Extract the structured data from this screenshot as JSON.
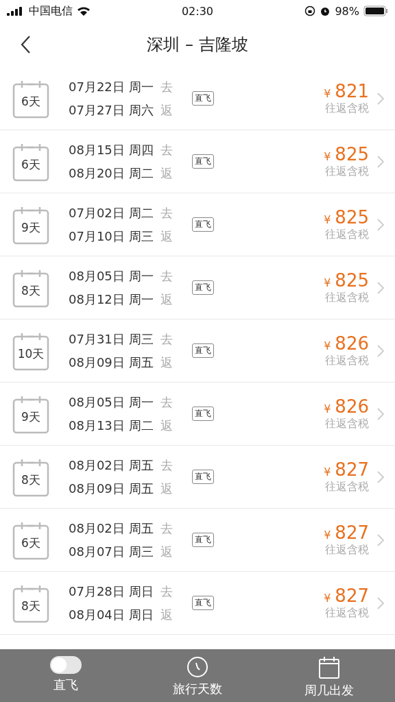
{
  "status_bar": {
    "carrier": "中国电信",
    "time": "02:30",
    "battery": "98%"
  },
  "nav": {
    "title": "深圳 – 吉隆坡"
  },
  "flights": [
    {
      "days": "6天",
      "out_date": "07月22日 周一",
      "out_tag": "去",
      "ret_date": "07月27日 周六",
      "ret_tag": "返",
      "badge": "直飞",
      "currency": "¥",
      "price": "821",
      "note": "往返含税"
    },
    {
      "days": "6天",
      "out_date": "08月15日 周四",
      "out_tag": "去",
      "ret_date": "08月20日 周二",
      "ret_tag": "返",
      "badge": "直飞",
      "currency": "¥",
      "price": "825",
      "note": "往返含税"
    },
    {
      "days": "9天",
      "out_date": "07月02日 周二",
      "out_tag": "去",
      "ret_date": "07月10日 周三",
      "ret_tag": "返",
      "badge": "直飞",
      "currency": "¥",
      "price": "825",
      "note": "往返含税"
    },
    {
      "days": "8天",
      "out_date": "08月05日 周一",
      "out_tag": "去",
      "ret_date": "08月12日 周一",
      "ret_tag": "返",
      "badge": "直飞",
      "currency": "¥",
      "price": "825",
      "note": "往返含税"
    },
    {
      "days": "10天",
      "out_date": "07月31日 周三",
      "out_tag": "去",
      "ret_date": "08月09日 周五",
      "ret_tag": "返",
      "badge": "直飞",
      "currency": "¥",
      "price": "826",
      "note": "往返含税"
    },
    {
      "days": "9天",
      "out_date": "08月05日 周一",
      "out_tag": "去",
      "ret_date": "08月13日 周二",
      "ret_tag": "返",
      "badge": "直飞",
      "currency": "¥",
      "price": "826",
      "note": "往返含税"
    },
    {
      "days": "8天",
      "out_date": "08月02日 周五",
      "out_tag": "去",
      "ret_date": "08月09日 周五",
      "ret_tag": "返",
      "badge": "直飞",
      "currency": "¥",
      "price": "827",
      "note": "往返含税"
    },
    {
      "days": "6天",
      "out_date": "08月02日 周五",
      "out_tag": "去",
      "ret_date": "08月07日 周三",
      "ret_tag": "返",
      "badge": "直飞",
      "currency": "¥",
      "price": "827",
      "note": "往返含税"
    },
    {
      "days": "8天",
      "out_date": "07月28日 周日",
      "out_tag": "去",
      "ret_date": "08月04日 周日",
      "ret_tag": "返",
      "badge": "直飞",
      "currency": "¥",
      "price": "827",
      "note": "往返含税"
    }
  ],
  "bottom_bar": [
    {
      "kind": "toggle",
      "label": "直飞",
      "on": false
    },
    {
      "kind": "clock",
      "label": "旅行天数"
    },
    {
      "kind": "calendar",
      "label": "周几出发"
    }
  ]
}
